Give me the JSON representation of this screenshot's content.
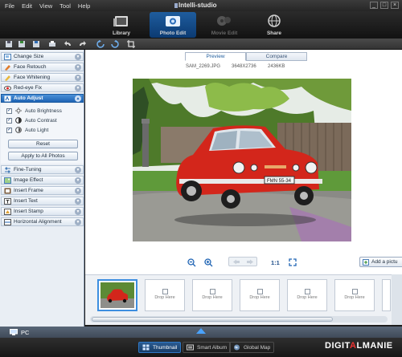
{
  "app": {
    "title": "Intelli-studio"
  },
  "menu": [
    "File",
    "Edit",
    "View",
    "Tool",
    "Help"
  ],
  "window_buttons": [
    "_",
    "□",
    "×"
  ],
  "modes": [
    {
      "label": "Library",
      "icon": "library-icon",
      "state": "normal"
    },
    {
      "label": "Photo Edit",
      "icon": "photo-edit-icon",
      "state": "active"
    },
    {
      "label": "Movie Edit",
      "icon": "movie-edit-icon",
      "state": "disabled"
    },
    {
      "label": "Share",
      "icon": "share-globe-icon",
      "state": "normal"
    }
  ],
  "toolbar_icons": [
    "save-icon",
    "save-as-icon",
    "save-copy-icon",
    "print-icon",
    "undo-icon",
    "redo-icon",
    "rotate-left-icon",
    "rotate-right-icon",
    "crop-icon"
  ],
  "left_panel": {
    "sections_top": [
      {
        "label": "Change Size",
        "icon": "resize-icon"
      },
      {
        "label": "Face Retouch",
        "icon": "face-retouch-icon"
      },
      {
        "label": "Face Whitening",
        "icon": "face-whitening-icon"
      },
      {
        "label": "Red-eye Fix",
        "icon": "red-eye-icon"
      }
    ],
    "auto_adjust": {
      "label": "Auto Adjust",
      "options": [
        {
          "label": "Auto Brightness",
          "checked": true,
          "icon": "brightness-icon"
        },
        {
          "label": "Auto Contrast",
          "checked": true,
          "icon": "contrast-icon"
        },
        {
          "label": "Auto Light",
          "checked": true,
          "icon": "light-icon"
        }
      ],
      "reset_label": "Reset",
      "apply_all_label": "Apply to All Photos"
    },
    "sections_bottom": [
      {
        "label": "Fine-Tuning",
        "icon": "fine-tuning-icon"
      },
      {
        "label": "Image Effect",
        "icon": "image-effect-icon"
      },
      {
        "label": "Insert Frame",
        "icon": "frame-icon"
      },
      {
        "label": "Insert Text",
        "icon": "text-icon"
      },
      {
        "label": "Insert Stamp",
        "icon": "stamp-icon"
      },
      {
        "label": "Horizontal Alignment",
        "icon": "align-icon"
      }
    ]
  },
  "view_tabs": {
    "preview": "Preview",
    "compare": "Compare",
    "active": "preview"
  },
  "file_info": {
    "name": "SAM_2269.JPG",
    "dimensions": "3648X2736",
    "size": "2436KB"
  },
  "photo": {
    "plate": "FMN 55-34"
  },
  "zoom_controls": {
    "zoom_out_icon": "zoom-out-icon",
    "zoom_in_icon": "zoom-in-icon",
    "ratio_label": "1:1",
    "fit_icon": "fit-screen-icon"
  },
  "add_picture_label": "Add a pictu",
  "filmstrip": {
    "drop_label": "Drop Here",
    "drop_slots": 6
  },
  "location_bar": {
    "label": "PC"
  },
  "bottom_tabs": [
    {
      "label": "Thumbnail",
      "icon": "thumbnail-icon",
      "active": true
    },
    {
      "label": "Smart Album",
      "icon": "smart-album-icon",
      "active": false
    },
    {
      "label": "Global Map",
      "icon": "global-map-icon",
      "active": false
    }
  ],
  "watermark": {
    "part1": "DIGIT",
    "part2": "A",
    "part3": "L",
    "part4": "MANIE"
  },
  "colors": {
    "accent": "#1f64b4",
    "car_red": "#d3261b",
    "chrome": "#2b2b2b"
  }
}
